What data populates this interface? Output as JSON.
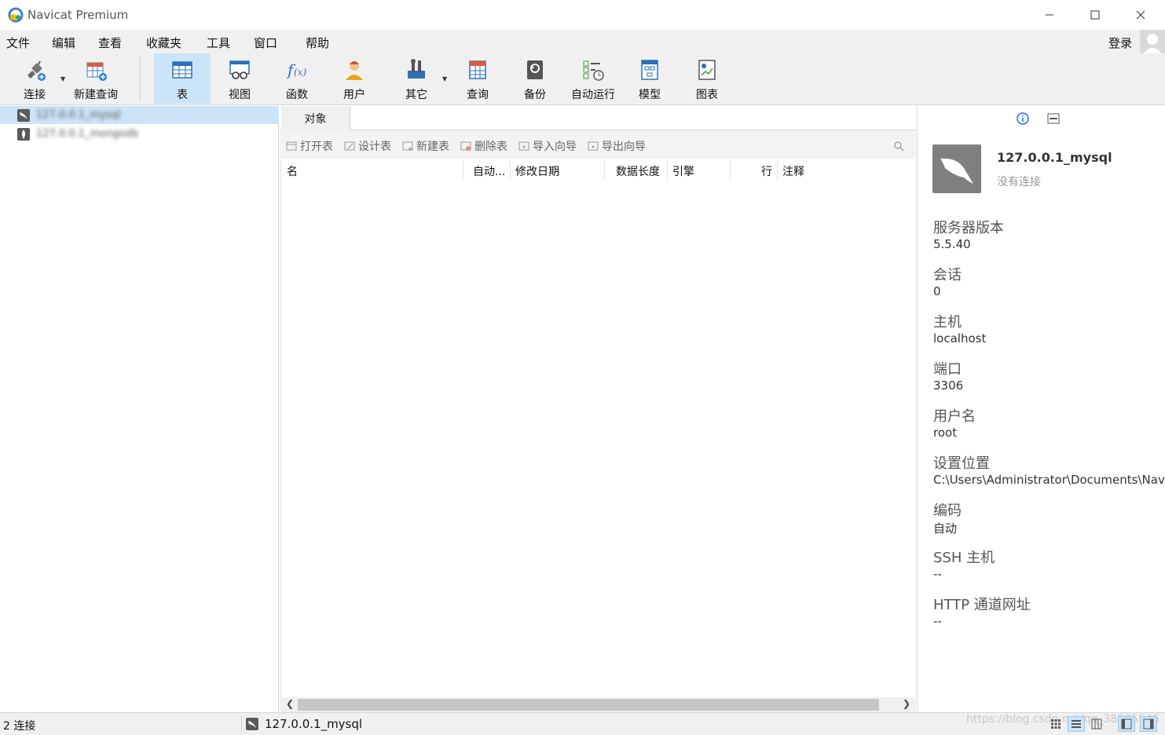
{
  "window": {
    "title": "Navicat Premium"
  },
  "menu": {
    "items": [
      "文件",
      "编辑",
      "查看",
      "收藏夹",
      "工具",
      "窗口",
      "帮助"
    ],
    "login_label": "登录"
  },
  "toolbar": {
    "items": [
      {
        "label": "连接",
        "icon": "plug-icon"
      },
      {
        "label": "新建查询",
        "icon": "new-query-icon"
      },
      {
        "label": "表",
        "icon": "table-icon"
      },
      {
        "label": "视图",
        "icon": "view-icon"
      },
      {
        "label": "函数",
        "icon": "function-icon"
      },
      {
        "label": "用户",
        "icon": "user-icon"
      },
      {
        "label": "其它",
        "icon": "tools-icon"
      },
      {
        "label": "查询",
        "icon": "query-icon"
      },
      {
        "label": "备份",
        "icon": "backup-icon"
      },
      {
        "label": "自动运行",
        "icon": "schedule-icon"
      },
      {
        "label": "模型",
        "icon": "model-icon"
      },
      {
        "label": "图表",
        "icon": "chart-icon"
      }
    ],
    "active": "表"
  },
  "sidebar": {
    "connections": [
      {
        "label": "127.0.0.1_mysql",
        "icon": "mysql-icon",
        "selected": true
      },
      {
        "label": "127.0.0.1_mongodb",
        "icon": "mongodb-icon",
        "selected": false
      }
    ]
  },
  "objects": {
    "tab_label": "对象",
    "actions": [
      "打开表",
      "设计表",
      "新建表",
      "删除表",
      "导入向导",
      "导出向导"
    ],
    "columns": [
      "名",
      "自动...",
      "修改日期",
      "数据长度",
      "引擎",
      "行",
      "注释"
    ]
  },
  "info": {
    "title": "127.0.0.1_mysql",
    "status": "没有连接",
    "properties": [
      {
        "label": "服务器版本",
        "value": "5.5.40"
      },
      {
        "label": "会话",
        "value": "0"
      },
      {
        "label": "主机",
        "value": "localhost"
      },
      {
        "label": "端口",
        "value": "3306"
      },
      {
        "label": "用户名",
        "value": "root"
      },
      {
        "label": "设置位置",
        "value": "C:\\Users\\Administrator\\Documents\\Navicat"
      },
      {
        "label": "编码",
        "value": "自动"
      },
      {
        "label": "SSH 主机",
        "value": "--"
      },
      {
        "label": "HTTP 通道网址",
        "value": "--"
      }
    ]
  },
  "status": {
    "connections": "2 连接",
    "current_connection": "127.0.0.1_mysql",
    "watermark": "https://blog.csdn.net/qq_38805546"
  },
  "colors": {
    "selection": "#cce4f7",
    "accent": "#1a73e8"
  }
}
